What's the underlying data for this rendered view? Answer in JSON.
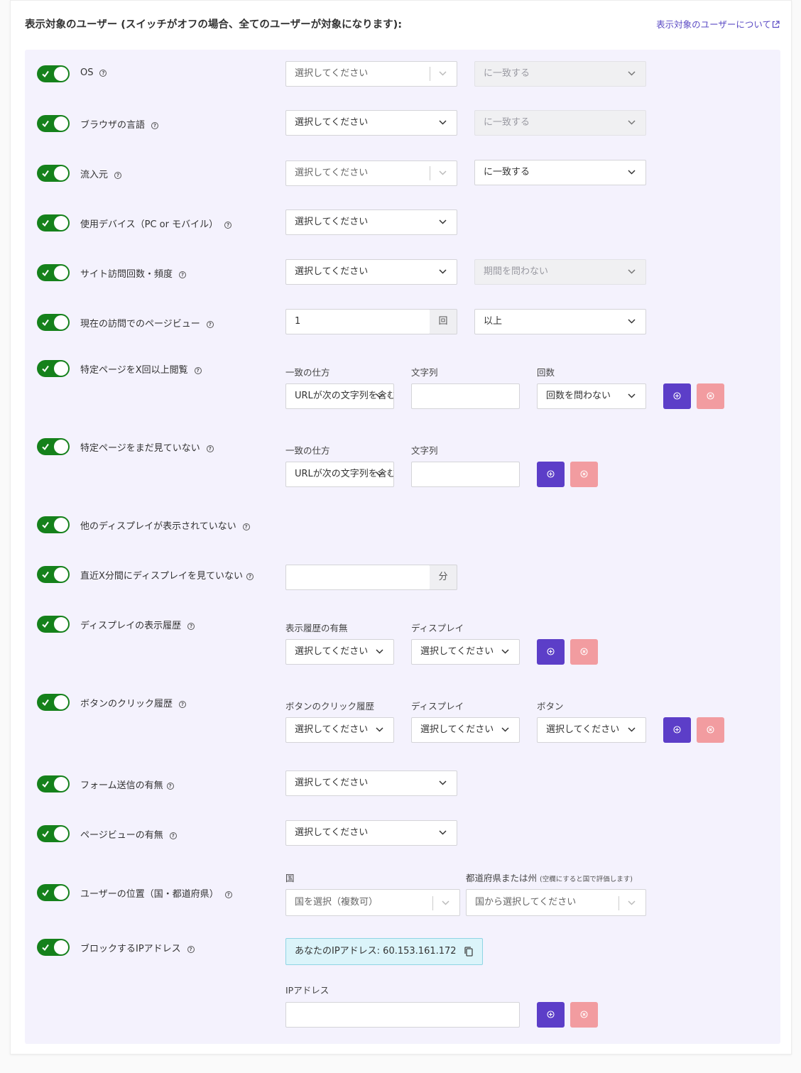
{
  "header": {
    "title": "表示対象のユーザー (スイッチがオフの場合、全てのユーザーが対象になります):",
    "help_link": "表示対象のユーザーについて"
  },
  "colors": {
    "toggle_on": "#15811b",
    "add_button": "#5c3ec8",
    "remove_button": "#f29ca0",
    "panel": "#f4f2fd",
    "link": "#5b4bc4",
    "ip_box": "#dbf4fa"
  },
  "icons": {
    "help": "help-circle-icon",
    "toggle": "check-icon",
    "dropdown": "chevron-down-icon",
    "add": "plus-circle-icon",
    "remove": "x-circle-icon",
    "external": "external-link-icon",
    "copy": "copy-icon"
  },
  "rows": {
    "os": {
      "label": "OS",
      "select": "選択してください",
      "match": "に一致する"
    },
    "browser_lang": {
      "label": "ブラウザの言語",
      "select": "選択してください",
      "match": "に一致する"
    },
    "referrer": {
      "label": "流入元",
      "select": "選択してください",
      "match": "に一致する"
    },
    "device": {
      "label": "使用デバイス（PC or モバイル）",
      "select": "選択してください"
    },
    "visit_count": {
      "label": "サイト訪問回数・頻度",
      "select": "選択してください",
      "period": "期間を問わない"
    },
    "pageviews": {
      "label": "現在の訪問でのページビュー",
      "value": "1",
      "unit": "回",
      "comparison": "以上"
    },
    "viewed_page": {
      "label": "特定ページをX回以上閲覧",
      "match_label": "一致の仕方",
      "string_label": "文字列",
      "count_label": "回数",
      "match_value": "URLが次の文字列を含む",
      "string_value": "",
      "count_value": "回数を問わない"
    },
    "not_viewed_page": {
      "label": "特定ページをまだ見ていない",
      "match_label": "一致の仕方",
      "string_label": "文字列",
      "match_value": "URLが次の文字列を含む",
      "string_value": ""
    },
    "no_other_display": {
      "label": "他のディスプレイが表示されていない"
    },
    "not_seen_recent": {
      "label": "直近X分間にディスプレイを見ていない",
      "value": "",
      "unit": "分"
    },
    "display_history": {
      "label": "ディスプレイの表示履歴",
      "history_label": "表示履歴の有無",
      "display_label": "ディスプレイ",
      "history_value": "選択してください",
      "display_value": "選択してください"
    },
    "button_clicks": {
      "label": "ボタンのクリック履歴",
      "history_label": "ボタンのクリック履歴",
      "display_label": "ディスプレイ",
      "button_label": "ボタン",
      "history_value": "選択してください",
      "display_value": "選択してください",
      "button_value": "選択してください"
    },
    "form_submit": {
      "label": "フォーム送信の有無",
      "select": "選択してください"
    },
    "pageview_presence": {
      "label": "ページビューの有無",
      "select": "選択してください"
    },
    "location": {
      "label": "ユーザーの位置（国・都道府県）",
      "country_label": "国",
      "region_label": "都道府県または州",
      "region_note": "(空欄にすると国で評価します)",
      "country_placeholder": "国を選択（複数可）",
      "region_placeholder": "国から選択してください"
    },
    "block_ip": {
      "label": "ブロックするIPアドレス",
      "ip_notice": "あなたのIPアドレス: 60.153.161.172",
      "ip_label": "IPアドレス",
      "ip_value": ""
    }
  }
}
